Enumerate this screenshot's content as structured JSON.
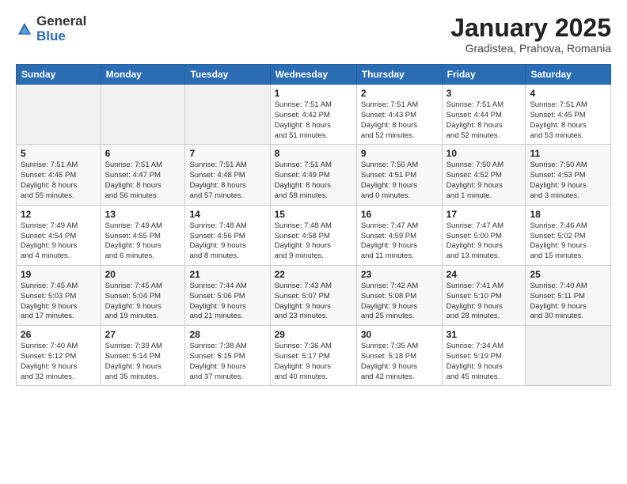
{
  "logo": {
    "general": "General",
    "blue": "Blue"
  },
  "title": "January 2025",
  "subtitle": "Gradistea, Prahova, Romania",
  "days_of_week": [
    "Sunday",
    "Monday",
    "Tuesday",
    "Wednesday",
    "Thursday",
    "Friday",
    "Saturday"
  ],
  "weeks": [
    [
      {
        "day": "",
        "info": ""
      },
      {
        "day": "",
        "info": ""
      },
      {
        "day": "",
        "info": ""
      },
      {
        "day": "1",
        "info": "Sunrise: 7:51 AM\nSunset: 4:42 PM\nDaylight: 8 hours\nand 51 minutes."
      },
      {
        "day": "2",
        "info": "Sunrise: 7:51 AM\nSunset: 4:43 PM\nDaylight: 8 hours\nand 52 minutes."
      },
      {
        "day": "3",
        "info": "Sunrise: 7:51 AM\nSunset: 4:44 PM\nDaylight: 8 hours\nand 52 minutes."
      },
      {
        "day": "4",
        "info": "Sunrise: 7:51 AM\nSunset: 4:45 PM\nDaylight: 8 hours\nand 53 minutes."
      }
    ],
    [
      {
        "day": "5",
        "info": "Sunrise: 7:51 AM\nSunset: 4:46 PM\nDaylight: 8 hours\nand 55 minutes."
      },
      {
        "day": "6",
        "info": "Sunrise: 7:51 AM\nSunset: 4:47 PM\nDaylight: 8 hours\nand 56 minutes."
      },
      {
        "day": "7",
        "info": "Sunrise: 7:51 AM\nSunset: 4:48 PM\nDaylight: 8 hours\nand 57 minutes."
      },
      {
        "day": "8",
        "info": "Sunrise: 7:51 AM\nSunset: 4:49 PM\nDaylight: 8 hours\nand 58 minutes."
      },
      {
        "day": "9",
        "info": "Sunrise: 7:50 AM\nSunset: 4:51 PM\nDaylight: 9 hours\nand 0 minutes."
      },
      {
        "day": "10",
        "info": "Sunrise: 7:50 AM\nSunset: 4:52 PM\nDaylight: 9 hours\nand 1 minute."
      },
      {
        "day": "11",
        "info": "Sunrise: 7:50 AM\nSunset: 4:53 PM\nDaylight: 9 hours\nand 3 minutes."
      }
    ],
    [
      {
        "day": "12",
        "info": "Sunrise: 7:49 AM\nSunset: 4:54 PM\nDaylight: 9 hours\nand 4 minutes."
      },
      {
        "day": "13",
        "info": "Sunrise: 7:49 AM\nSunset: 4:55 PM\nDaylight: 9 hours\nand 6 minutes."
      },
      {
        "day": "14",
        "info": "Sunrise: 7:48 AM\nSunset: 4:56 PM\nDaylight: 9 hours\nand 8 minutes."
      },
      {
        "day": "15",
        "info": "Sunrise: 7:48 AM\nSunset: 4:58 PM\nDaylight: 9 hours\nand 9 minutes."
      },
      {
        "day": "16",
        "info": "Sunrise: 7:47 AM\nSunset: 4:59 PM\nDaylight: 9 hours\nand 11 minutes."
      },
      {
        "day": "17",
        "info": "Sunrise: 7:47 AM\nSunset: 5:00 PM\nDaylight: 9 hours\nand 13 minutes."
      },
      {
        "day": "18",
        "info": "Sunrise: 7:46 AM\nSunset: 5:02 PM\nDaylight: 9 hours\nand 15 minutes."
      }
    ],
    [
      {
        "day": "19",
        "info": "Sunrise: 7:45 AM\nSunset: 5:03 PM\nDaylight: 9 hours\nand 17 minutes."
      },
      {
        "day": "20",
        "info": "Sunrise: 7:45 AM\nSunset: 5:04 PM\nDaylight: 9 hours\nand 19 minutes."
      },
      {
        "day": "21",
        "info": "Sunrise: 7:44 AM\nSunset: 5:06 PM\nDaylight: 9 hours\nand 21 minutes."
      },
      {
        "day": "22",
        "info": "Sunrise: 7:43 AM\nSunset: 5:07 PM\nDaylight: 9 hours\nand 23 minutes."
      },
      {
        "day": "23",
        "info": "Sunrise: 7:42 AM\nSunset: 5:08 PM\nDaylight: 9 hours\nand 25 minutes."
      },
      {
        "day": "24",
        "info": "Sunrise: 7:41 AM\nSunset: 5:10 PM\nDaylight: 9 hours\nand 28 minutes."
      },
      {
        "day": "25",
        "info": "Sunrise: 7:40 AM\nSunset: 5:11 PM\nDaylight: 9 hours\nand 30 minutes."
      }
    ],
    [
      {
        "day": "26",
        "info": "Sunrise: 7:40 AM\nSunset: 5:12 PM\nDaylight: 9 hours\nand 32 minutes."
      },
      {
        "day": "27",
        "info": "Sunrise: 7:39 AM\nSunset: 5:14 PM\nDaylight: 9 hours\nand 35 minutes."
      },
      {
        "day": "28",
        "info": "Sunrise: 7:38 AM\nSunset: 5:15 PM\nDaylight: 9 hours\nand 37 minutes."
      },
      {
        "day": "29",
        "info": "Sunrise: 7:36 AM\nSunset: 5:17 PM\nDaylight: 9 hours\nand 40 minutes."
      },
      {
        "day": "30",
        "info": "Sunrise: 7:35 AM\nSunset: 5:18 PM\nDaylight: 9 hours\nand 42 minutes."
      },
      {
        "day": "31",
        "info": "Sunrise: 7:34 AM\nSunset: 5:19 PM\nDaylight: 9 hours\nand 45 minutes."
      },
      {
        "day": "",
        "info": ""
      }
    ]
  ]
}
